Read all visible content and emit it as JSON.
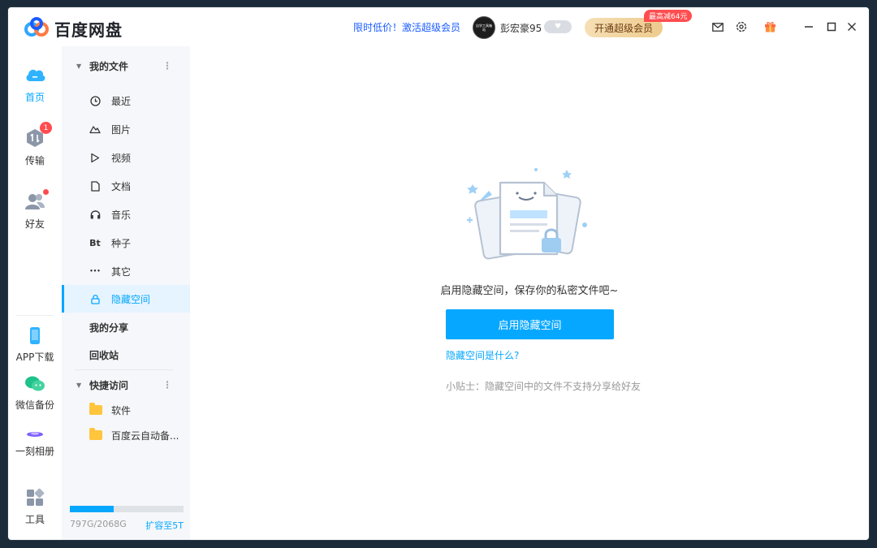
{
  "app": {
    "title": "百度网盘"
  },
  "header": {
    "promo_text": "限时低价！激活超级会员",
    "avatar_text": "自学工具箱站",
    "username": "彭宏豪95",
    "level_badge": "♥",
    "vip_button": "开通超级会员",
    "discount_badge": "最高减64元",
    "icons": [
      "mail-icon",
      "settings-icon",
      "gift-icon",
      "minimize-icon",
      "maximize-icon",
      "close-icon"
    ]
  },
  "rail": {
    "items": [
      {
        "label": "首页",
        "icon": "cloud-icon"
      },
      {
        "label": "传输",
        "icon": "transfer-icon",
        "badge": "1"
      },
      {
        "label": "好友",
        "icon": "friends-icon"
      },
      {
        "label": "APP下载",
        "icon": "phone-icon"
      },
      {
        "label": "微信备份",
        "icon": "wechat-icon"
      },
      {
        "label": "一刻相册",
        "icon": "album-icon"
      },
      {
        "label": "工具",
        "icon": "tools-icon"
      }
    ]
  },
  "sidebar": {
    "my_files": "我的文件",
    "items": [
      {
        "label": "最近",
        "icon": "clock-icon"
      },
      {
        "label": "图片",
        "icon": "image-icon"
      },
      {
        "label": "视频",
        "icon": "play-icon"
      },
      {
        "label": "文档",
        "icon": "document-icon"
      },
      {
        "label": "音乐",
        "icon": "headphone-icon"
      },
      {
        "label": "种子",
        "icon": "bt-icon",
        "glyph": "Bt"
      },
      {
        "label": "其它",
        "icon": "more-icon",
        "glyph": "•••"
      },
      {
        "label": "隐藏空间",
        "icon": "lock-icon"
      }
    ],
    "my_share": "我的分享",
    "recycle": "回收站",
    "quick_access": "快捷访问",
    "quick_items": [
      {
        "label": "软件"
      },
      {
        "label": "百度云自动备..."
      }
    ],
    "quota_text": "797G/2068G",
    "quota_used_fraction": 0.385,
    "expand_link": "扩容至5T"
  },
  "main": {
    "empty_title": "启用隐藏空间，保存你的私密文件吧~",
    "enable_button": "启用隐藏空间",
    "whatis_link": "隐藏空间是什么?",
    "tip": "小贴士：隐藏空间中的文件不支持分享给好友"
  },
  "colors": {
    "accent": "#06a7ff",
    "promo": "#1a5cff",
    "badge": "#ff4d4f",
    "folder": "#ffc53d"
  }
}
